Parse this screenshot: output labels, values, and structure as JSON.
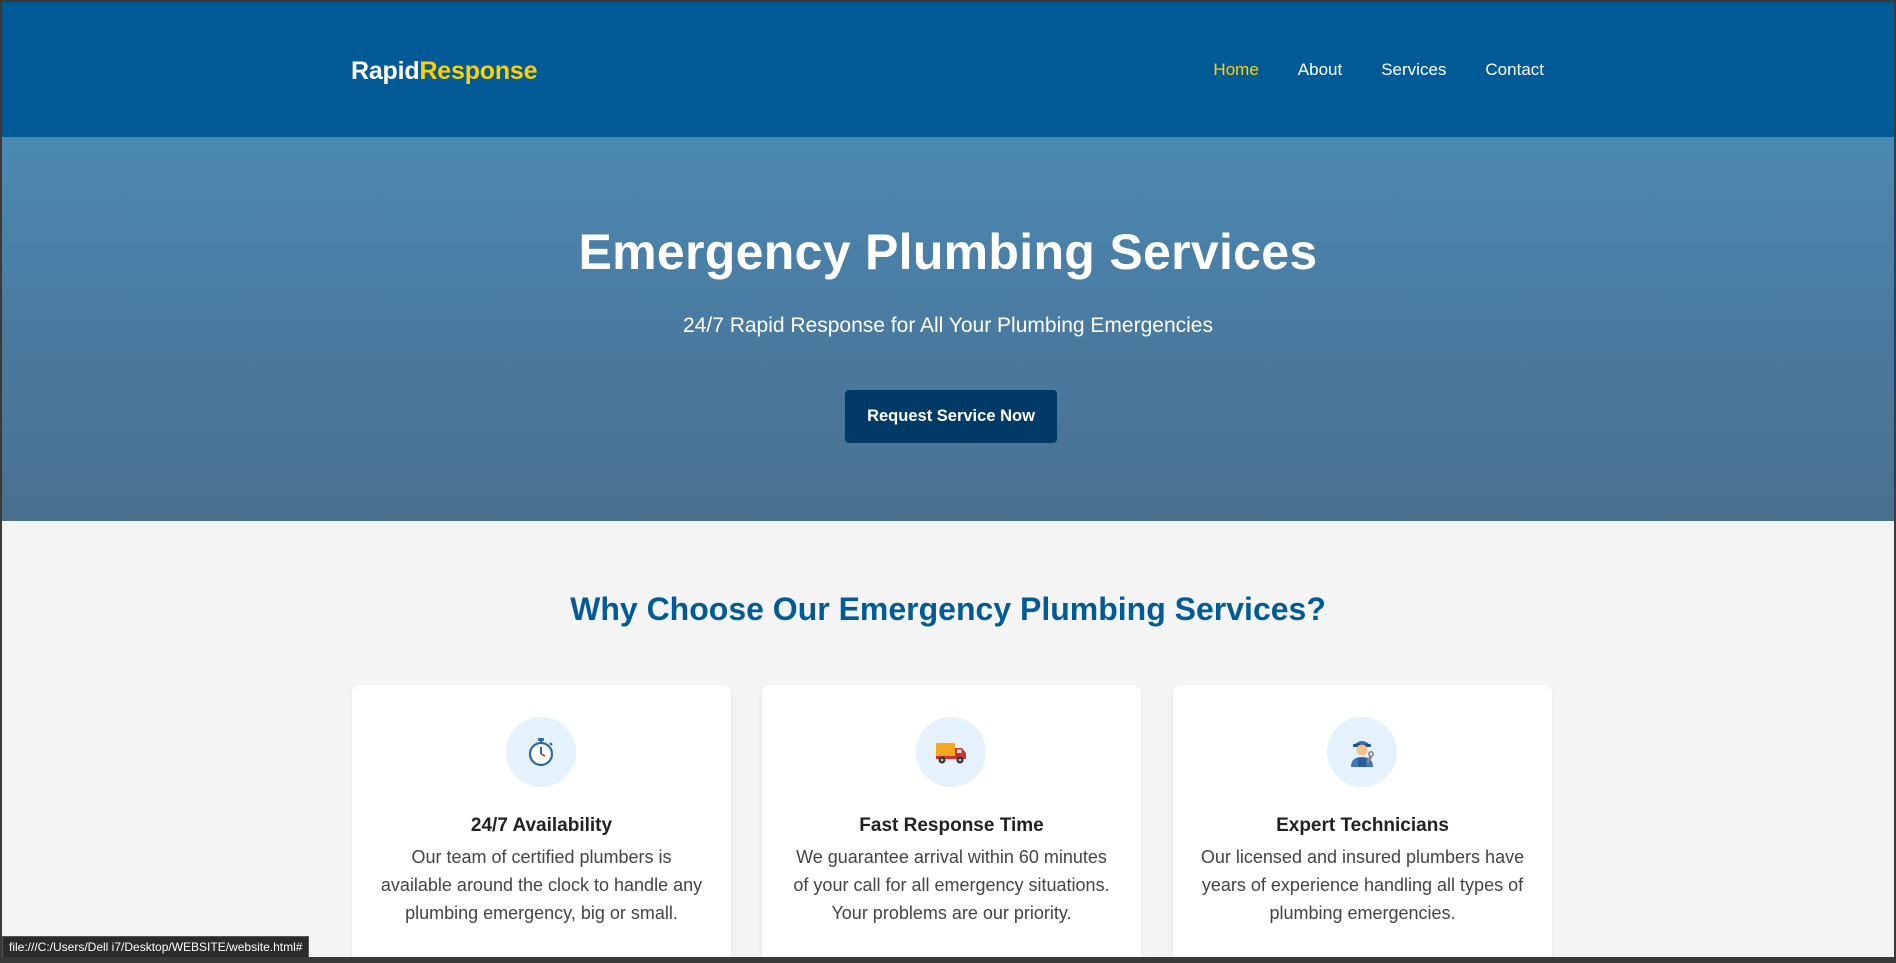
{
  "header": {
    "logo_part1": "Rapid",
    "logo_part2": "Response",
    "nav": [
      {
        "label": "Home",
        "active": true
      },
      {
        "label": "About"
      },
      {
        "label": "Services"
      },
      {
        "label": "Contact"
      }
    ]
  },
  "hero": {
    "title": "Emergency Plumbing Services",
    "subtitle": "24/7 Rapid Response for All Your Plumbing Emergencies",
    "cta_label": "Request Service Now"
  },
  "why": {
    "title": "Why Choose Our Emergency Plumbing Services?",
    "cards": [
      {
        "icon": "stopwatch-icon",
        "title": "24/7 Availability",
        "text": "Our team of certified plumbers is available around the clock to handle any plumbing emergency, big or small."
      },
      {
        "icon": "truck-icon",
        "title": "Fast Response Time",
        "text": "We guarantee arrival within 60 minutes of your call for all emergency situations. Your problems are our priority."
      },
      {
        "icon": "technician-icon",
        "title": "Expert Technicians",
        "text": "Our licensed and insured plumbers have years of experience handling all types of plumbing emergencies."
      }
    ]
  },
  "status_bar": {
    "url": "file:///C:/Users/Dell i7/Desktop/WEBSITE/website.html#"
  },
  "colors": {
    "header_bg": "#025b97",
    "accent_yellow": "#ffd100",
    "cta_bg": "#003a67",
    "section_title": "#025b97"
  }
}
